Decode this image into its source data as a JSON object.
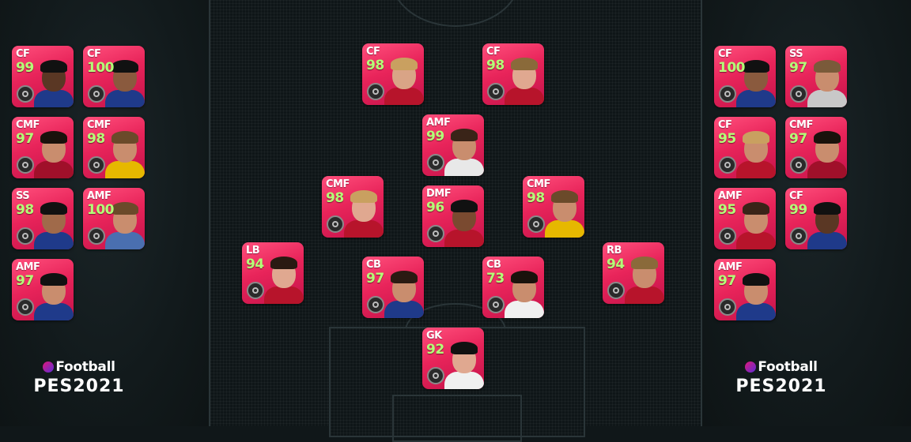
{
  "logo": {
    "brand": "Football",
    "title": "PES2021"
  },
  "colors": {
    "card": "#e8245a",
    "rating": "#b4ff78",
    "background": "#101719"
  },
  "left_bench": [
    {
      "pos": "CF",
      "ovr": "99"
    },
    {
      "pos": "CF",
      "ovr": "100"
    },
    {
      "pos": "CMF",
      "ovr": "97"
    },
    {
      "pos": "CMF",
      "ovr": "98"
    },
    {
      "pos": "SS",
      "ovr": "98"
    },
    {
      "pos": "AMF",
      "ovr": "100"
    },
    {
      "pos": "AMF",
      "ovr": "97"
    }
  ],
  "right_bench": [
    {
      "pos": "CF",
      "ovr": "100"
    },
    {
      "pos": "SS",
      "ovr": "97"
    },
    {
      "pos": "CF",
      "ovr": "95"
    },
    {
      "pos": "CMF",
      "ovr": "97"
    },
    {
      "pos": "AMF",
      "ovr": "95"
    },
    {
      "pos": "CF",
      "ovr": "99"
    },
    {
      "pos": "AMF",
      "ovr": "97"
    }
  ],
  "lineup": [
    {
      "pos": "CF",
      "ovr": "98"
    },
    {
      "pos": "CF",
      "ovr": "98"
    },
    {
      "pos": "AMF",
      "ovr": "99"
    },
    {
      "pos": "CMF",
      "ovr": "98"
    },
    {
      "pos": "DMF",
      "ovr": "96"
    },
    {
      "pos": "CMF",
      "ovr": "98"
    },
    {
      "pos": "LB",
      "ovr": "94"
    },
    {
      "pos": "CB",
      "ovr": "97"
    },
    {
      "pos": "CB",
      "ovr": "73"
    },
    {
      "pos": "RB",
      "ovr": "94"
    },
    {
      "pos": "GK",
      "ovr": "92"
    }
  ]
}
